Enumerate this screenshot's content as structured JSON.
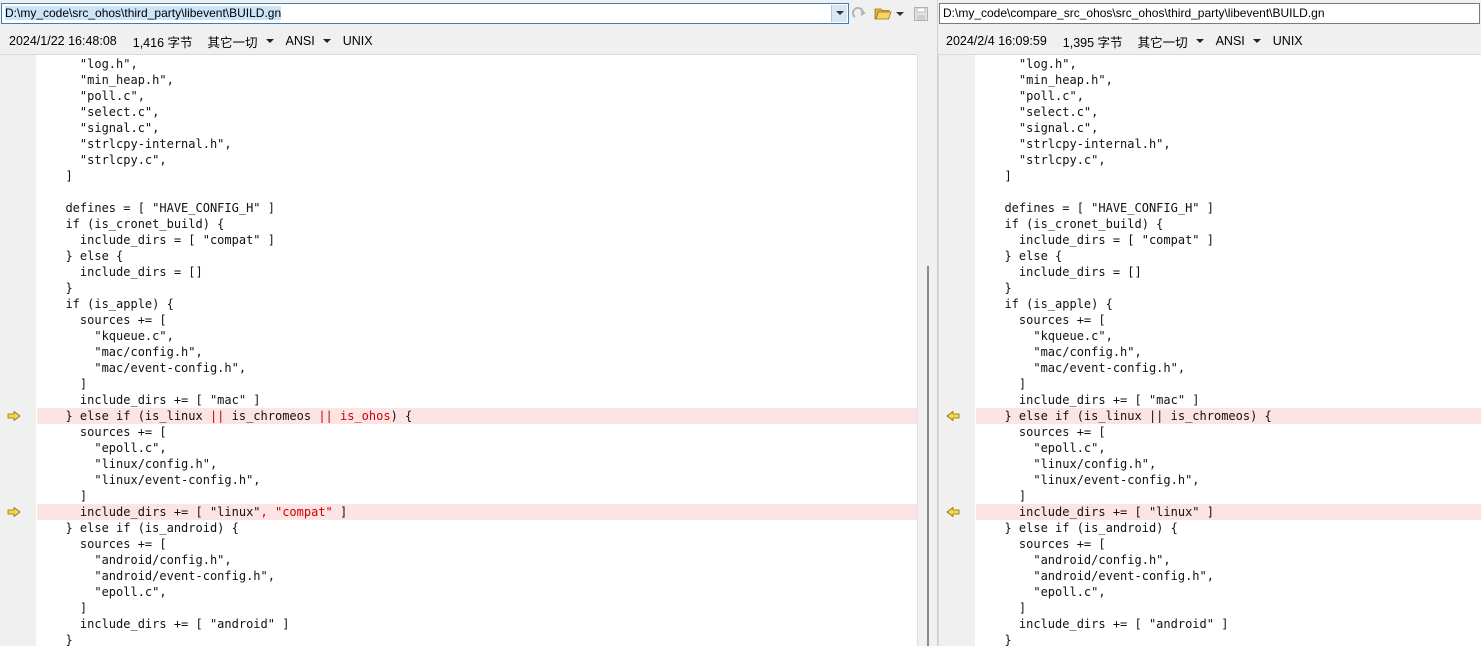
{
  "left": {
    "path": "D:\\my_code\\src_ohos\\third_party\\libevent\\BUILD.gn",
    "date": "2024/1/22 16:48:08",
    "size": "1,416 字节",
    "filter": "其它一切",
    "encoding": "ANSI",
    "eol": "UNIX",
    "lines": [
      {
        "segs": [
          {
            "t": "    \"log.h\","
          }
        ]
      },
      {
        "segs": [
          {
            "t": "    \"min_heap.h\","
          }
        ]
      },
      {
        "segs": [
          {
            "t": "    \"poll.c\","
          }
        ]
      },
      {
        "segs": [
          {
            "t": "    \"select.c\","
          }
        ]
      },
      {
        "segs": [
          {
            "t": "    \"signal.c\","
          }
        ]
      },
      {
        "segs": [
          {
            "t": "    \"strlcpy-internal.h\","
          }
        ]
      },
      {
        "segs": [
          {
            "t": "    \"strlcpy.c\","
          }
        ]
      },
      {
        "segs": [
          {
            "t": "  ]"
          }
        ]
      },
      {
        "segs": [
          {
            "t": ""
          }
        ]
      },
      {
        "segs": [
          {
            "t": "  defines = [ \"HAVE_CONFIG_H\" ]"
          }
        ]
      },
      {
        "segs": [
          {
            "t": "  if (is_cronet_build) {"
          }
        ]
      },
      {
        "segs": [
          {
            "t": "    include_dirs = [ \"compat\" ]"
          }
        ]
      },
      {
        "segs": [
          {
            "t": "  } else {"
          }
        ]
      },
      {
        "segs": [
          {
            "t": "    include_dirs = []"
          }
        ]
      },
      {
        "segs": [
          {
            "t": "  }"
          }
        ]
      },
      {
        "segs": [
          {
            "t": "  if (is_apple) {"
          }
        ]
      },
      {
        "segs": [
          {
            "t": "    sources += ["
          }
        ]
      },
      {
        "segs": [
          {
            "t": "      \"kqueue.c\","
          }
        ]
      },
      {
        "segs": [
          {
            "t": "      \"mac/config.h\","
          }
        ]
      },
      {
        "segs": [
          {
            "t": "      \"mac/event-config.h\","
          }
        ]
      },
      {
        "segs": [
          {
            "t": "    ]"
          }
        ]
      },
      {
        "segs": [
          {
            "t": "    include_dirs += [ \"mac\" ]"
          }
        ]
      },
      {
        "diff": true,
        "segs": [
          {
            "t": "  } else if (is_linux "
          },
          {
            "t": "||",
            "hl": true
          },
          {
            "t": " is_chromeos "
          },
          {
            "t": "|| is_ohos",
            "hl": true
          },
          {
            "t": ") {"
          }
        ]
      },
      {
        "segs": [
          {
            "t": "    sources += ["
          }
        ]
      },
      {
        "segs": [
          {
            "t": "      \"epoll.c\","
          }
        ]
      },
      {
        "segs": [
          {
            "t": "      \"linux/config.h\","
          }
        ]
      },
      {
        "segs": [
          {
            "t": "      \"linux/event-config.h\","
          }
        ]
      },
      {
        "segs": [
          {
            "t": "    ]"
          }
        ]
      },
      {
        "diff": true,
        "segs": [
          {
            "t": "    include_dirs += [ \"linux\""
          },
          {
            "t": ", \"compat\"",
            "hl": true
          },
          {
            "t": " ]"
          }
        ]
      },
      {
        "segs": [
          {
            "t": "  } else if (is_android) {"
          }
        ]
      },
      {
        "segs": [
          {
            "t": "    sources += ["
          }
        ]
      },
      {
        "segs": [
          {
            "t": "      \"android/config.h\","
          }
        ]
      },
      {
        "segs": [
          {
            "t": "      \"android/event-config.h\","
          }
        ]
      },
      {
        "segs": [
          {
            "t": "      \"epoll.c\","
          }
        ]
      },
      {
        "segs": [
          {
            "t": "    ]"
          }
        ]
      },
      {
        "segs": [
          {
            "t": "    include_dirs += [ \"android\" ]"
          }
        ]
      },
      {
        "segs": [
          {
            "t": "  }"
          }
        ]
      }
    ]
  },
  "right": {
    "path": "D:\\my_code\\compare_src_ohos\\src_ohos\\third_party\\libevent\\BUILD.gn",
    "date": "2024/2/4 16:09:59",
    "size": "1,395 字节",
    "filter": "其它一切",
    "encoding": "ANSI",
    "eol": "UNIX",
    "lines": [
      {
        "segs": [
          {
            "t": "    \"log.h\","
          }
        ]
      },
      {
        "segs": [
          {
            "t": "    \"min_heap.h\","
          }
        ]
      },
      {
        "segs": [
          {
            "t": "    \"poll.c\","
          }
        ]
      },
      {
        "segs": [
          {
            "t": "    \"select.c\","
          }
        ]
      },
      {
        "segs": [
          {
            "t": "    \"signal.c\","
          }
        ]
      },
      {
        "segs": [
          {
            "t": "    \"strlcpy-internal.h\","
          }
        ]
      },
      {
        "segs": [
          {
            "t": "    \"strlcpy.c\","
          }
        ]
      },
      {
        "segs": [
          {
            "t": "  ]"
          }
        ]
      },
      {
        "segs": [
          {
            "t": ""
          }
        ]
      },
      {
        "segs": [
          {
            "t": "  defines = [ \"HAVE_CONFIG_H\" ]"
          }
        ]
      },
      {
        "segs": [
          {
            "t": "  if (is_cronet_build) {"
          }
        ]
      },
      {
        "segs": [
          {
            "t": "    include_dirs = [ \"compat\" ]"
          }
        ]
      },
      {
        "segs": [
          {
            "t": "  } else {"
          }
        ]
      },
      {
        "segs": [
          {
            "t": "    include_dirs = []"
          }
        ]
      },
      {
        "segs": [
          {
            "t": "  }"
          }
        ]
      },
      {
        "segs": [
          {
            "t": "  if (is_apple) {"
          }
        ]
      },
      {
        "segs": [
          {
            "t": "    sources += ["
          }
        ]
      },
      {
        "segs": [
          {
            "t": "      \"kqueue.c\","
          }
        ]
      },
      {
        "segs": [
          {
            "t": "      \"mac/config.h\","
          }
        ]
      },
      {
        "segs": [
          {
            "t": "      \"mac/event-config.h\","
          }
        ]
      },
      {
        "segs": [
          {
            "t": "    ]"
          }
        ]
      },
      {
        "segs": [
          {
            "t": "    include_dirs += [ \"mac\" ]"
          }
        ]
      },
      {
        "diff": true,
        "segs": [
          {
            "t": "  } else if (is_linux || is_chromeos) {"
          }
        ]
      },
      {
        "segs": [
          {
            "t": "    sources += ["
          }
        ]
      },
      {
        "segs": [
          {
            "t": "      \"epoll.c\","
          }
        ]
      },
      {
        "segs": [
          {
            "t": "      \"linux/config.h\","
          }
        ]
      },
      {
        "segs": [
          {
            "t": "      \"linux/event-config.h\","
          }
        ]
      },
      {
        "segs": [
          {
            "t": "    ]"
          }
        ]
      },
      {
        "diff": true,
        "segs": [
          {
            "t": "    include_dirs += [ \"linux\" ]"
          }
        ]
      },
      {
        "segs": [
          {
            "t": "  } else if (is_android) {"
          }
        ]
      },
      {
        "segs": [
          {
            "t": "    sources += ["
          }
        ]
      },
      {
        "segs": [
          {
            "t": "      \"android/config.h\","
          }
        ]
      },
      {
        "segs": [
          {
            "t": "      \"android/event-config.h\","
          }
        ]
      },
      {
        "segs": [
          {
            "t": "      \"epoll.c\","
          }
        ]
      },
      {
        "segs": [
          {
            "t": "    ]"
          }
        ]
      },
      {
        "segs": [
          {
            "t": "    include_dirs += [ \"android\" ]"
          }
        ]
      },
      {
        "segs": [
          {
            "t": "  }"
          }
        ]
      }
    ]
  },
  "icons": {
    "redo": "redo-icon",
    "open": "open-folder-icon",
    "save": "save-icon",
    "left_arrow": "copy-right-arrow-icon",
    "right_arrow": "copy-left-arrow-icon"
  },
  "colors": {
    "diff_bg": "#fde4e4",
    "diff_text": "#d00000",
    "arrow_fill": "#f5d74a",
    "gutter": "#f0f0f0"
  }
}
